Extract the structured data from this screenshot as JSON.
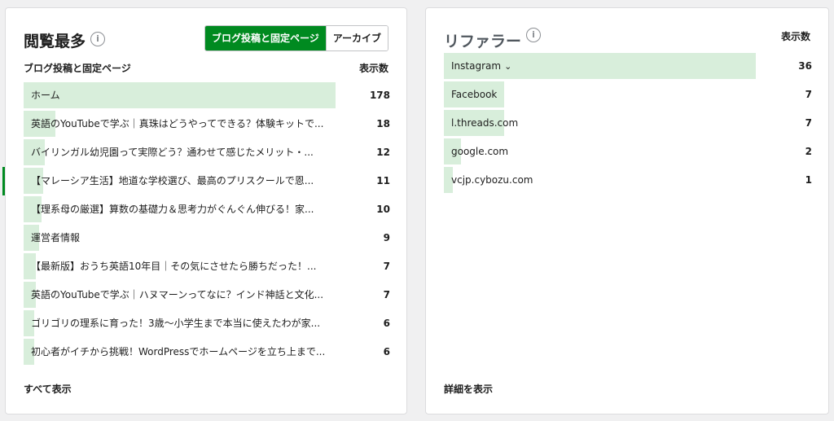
{
  "left": {
    "title": "閲覧最多",
    "info": "i",
    "toggle": {
      "active": "ブログ投稿と固定ページ",
      "inactive": "アーカイブ"
    },
    "col_label": "ブログ投稿と固定ページ",
    "col_value": "表示数",
    "max": 178,
    "rows": [
      {
        "label": "ホーム",
        "value": 178
      },
      {
        "label": "英語のYouTubeで学ぶ｜真珠はどうやってできる？体験キットで...",
        "value": 18
      },
      {
        "label": "バイリンガル幼児園って実際どう？通わせて感じたメリット・...",
        "value": 12
      },
      {
        "label": "【マレーシア生活】地道な学校選び、最高のプリスクールで恩...",
        "value": 11
      },
      {
        "label": "【理系母の厳選】算数の基礎力＆思考力がぐんぐん伸びる！家...",
        "value": 10
      },
      {
        "label": "運営者情報",
        "value": 9
      },
      {
        "label": "【最新版】おうち英語10年目｜その気にさせたら勝ちだった！...",
        "value": 7
      },
      {
        "label": "英語のYouTubeで学ぶ｜ハヌマーンってなに？インド神話と文化...",
        "value": 7
      },
      {
        "label": "ゴリゴリの理系に育った！3歳〜小学生まで本当に使えたわが家...",
        "value": 6
      },
      {
        "label": "初心者がイチから挑戦！WordPressでホームページを立ち上まで...",
        "value": 6
      }
    ],
    "footer": "すべて表示"
  },
  "right": {
    "title": "リファラー",
    "info": "i",
    "col_value": "表示数",
    "max": 36,
    "rows": [
      {
        "label": "Instagram",
        "value": 36,
        "expandable": true
      },
      {
        "label": "Facebook",
        "value": 7
      },
      {
        "label": "l.threads.com",
        "value": 7
      },
      {
        "label": "google.com",
        "value": 2
      },
      {
        "label": "vcjp.cybozu.com",
        "value": 1
      }
    ],
    "footer": "詳細を表示"
  }
}
